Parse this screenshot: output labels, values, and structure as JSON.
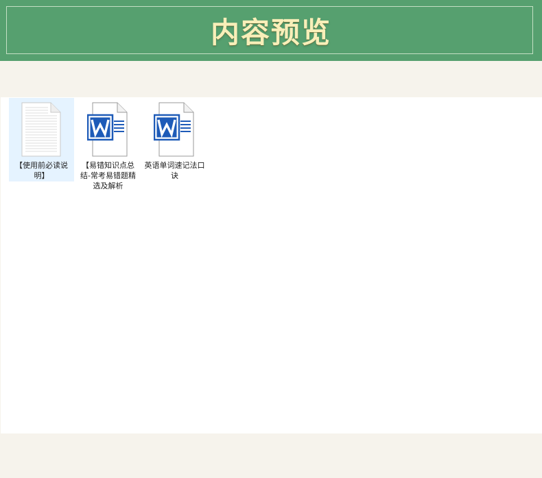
{
  "banner": {
    "title": "内容预览"
  },
  "explorer": {
    "files": [
      {
        "label": "【使用前必读说明】",
        "icon": "text-document-icon",
        "selected": true
      },
      {
        "label": "【易错知识点总结-常考易错题精选及解析",
        "icon": "word-document-icon",
        "selected": false
      },
      {
        "label": "英语单词速记法口诀",
        "icon": "word-document-icon",
        "selected": false
      }
    ]
  },
  "colors": {
    "banner_bg": "#56a06f",
    "title_color": "#f8efb9",
    "page_bg": "#f6f3ec",
    "selection_bg": "#e5f3ff",
    "word_blue": "#1e5bb8"
  }
}
